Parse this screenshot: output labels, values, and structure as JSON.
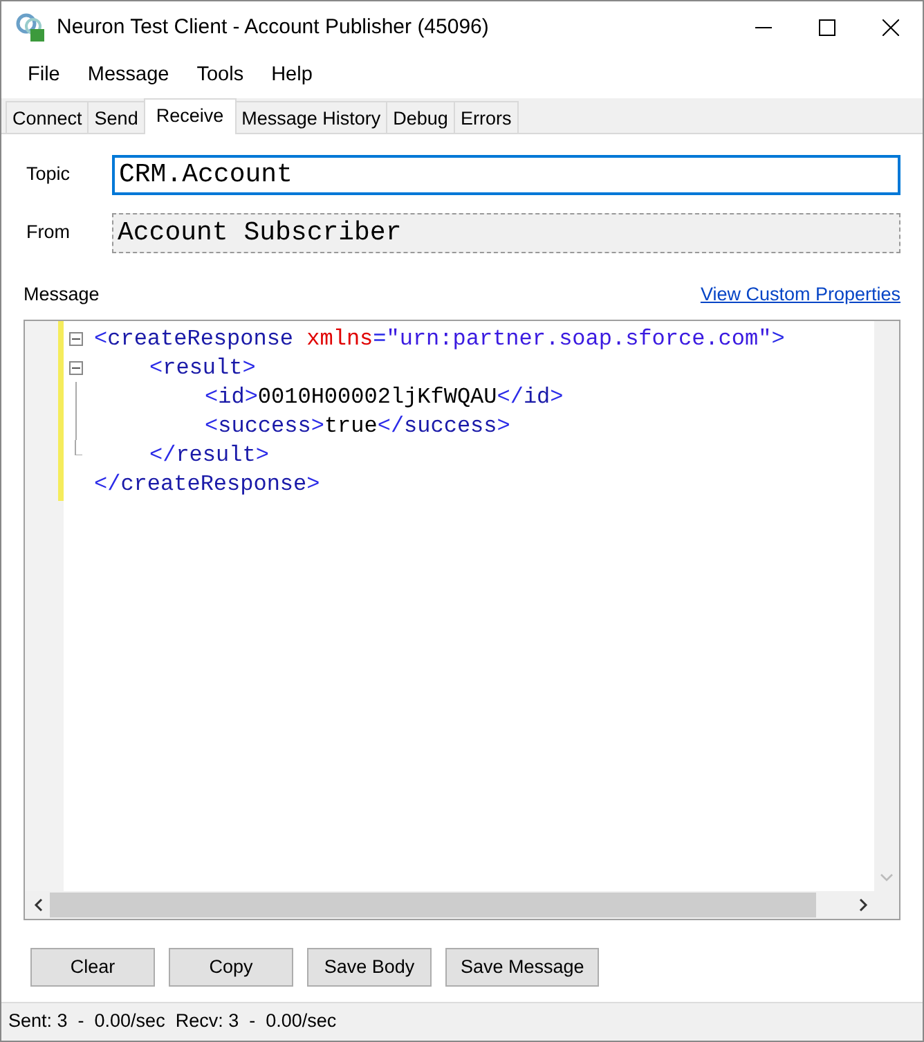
{
  "window": {
    "title": "Neuron Test Client - Account Publisher (45096)"
  },
  "menu": [
    "File",
    "Message",
    "Tools",
    "Help"
  ],
  "tabs": [
    {
      "label": "Connect",
      "selected": false
    },
    {
      "label": "Send",
      "selected": false
    },
    {
      "label": "Receive",
      "selected": true
    },
    {
      "label": "Message History",
      "selected": false
    },
    {
      "label": "Debug",
      "selected": false
    },
    {
      "label": "Errors",
      "selected": false
    }
  ],
  "fields": [
    {
      "label": "Topic",
      "value": "CRM.Account",
      "disabled": false
    },
    {
      "label": "From",
      "value": "Account Subscriber",
      "disabled": true
    }
  ],
  "message": {
    "label": "Message",
    "link": "View Custom Properties",
    "xml": [
      {
        "expanded": true,
        "open": [
          {
            "kind": "punct",
            "text": "<"
          },
          {
            "kind": "tag",
            "text": "createResponse"
          },
          {
            "kind": "attr",
            "text": " xmlns"
          },
          {
            "kind": "punct",
            "text": "="
          },
          {
            "kind": "value",
            "text": "\"urn:partner.soap.sforce.com\""
          },
          {
            "kind": "punct",
            "text": ">"
          }
        ],
        "children": [
          {
            "expanded": true,
            "open": [
              {
                "kind": "punct",
                "text": "<"
              },
              {
                "kind": "tag",
                "text": "result"
              },
              {
                "kind": "punct",
                "text": ">"
              }
            ],
            "children": [
              {
                "open": [
                  {
                    "kind": "punct",
                    "text": "<"
                  },
                  {
                    "kind": "tag",
                    "text": "id"
                  },
                  {
                    "kind": "punct",
                    "text": ">"
                  },
                  {
                    "kind": "text",
                    "text": "0010H00002ljKfWQAU"
                  },
                  {
                    "kind": "punct",
                    "text": "</"
                  },
                  {
                    "kind": "tag",
                    "text": "id"
                  },
                  {
                    "kind": "punct",
                    "text": ">"
                  }
                ]
              },
              {
                "open": [
                  {
                    "kind": "punct",
                    "text": "<"
                  },
                  {
                    "kind": "tag",
                    "text": "success"
                  },
                  {
                    "kind": "punct",
                    "text": ">"
                  },
                  {
                    "kind": "text",
                    "text": "true"
                  },
                  {
                    "kind": "punct",
                    "text": "</"
                  },
                  {
                    "kind": "tag",
                    "text": "success"
                  },
                  {
                    "kind": "punct",
                    "text": ">"
                  }
                ]
              }
            ],
            "close": [
              {
                "kind": "punct",
                "text": "</"
              },
              {
                "kind": "tag",
                "text": "result"
              },
              {
                "kind": "punct",
                "text": ">"
              }
            ]
          }
        ],
        "close": [
          {
            "kind": "punct",
            "text": "</"
          },
          {
            "kind": "tag",
            "text": "createResponse"
          },
          {
            "kind": "punct",
            "text": ">"
          }
        ]
      }
    ]
  },
  "buttons": [
    "Clear",
    "Copy",
    "Save Body",
    "Save Message"
  ],
  "status_bar": "Sent: 3  -  0.00/sec  Recv: 3  -  0.00/sec"
}
